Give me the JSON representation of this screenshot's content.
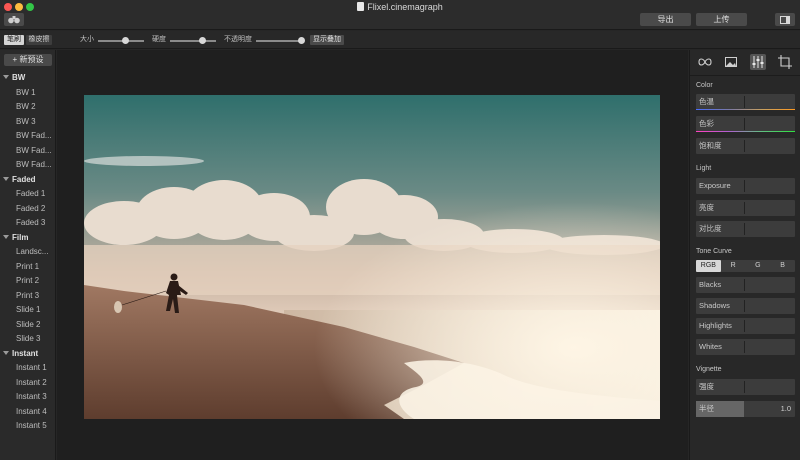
{
  "window": {
    "title": "Flixel.cinemagraph"
  },
  "header": {
    "export_label": "导出",
    "upload_label": "上传"
  },
  "toolbar": {
    "brush_label": "笔刷",
    "eraser_label": "橡皮擦",
    "size_label": "大小",
    "hardness_label": "硬度",
    "opacity_label": "不透明度",
    "show_overlay_label": "显示叠加",
    "size_value": 0.6,
    "hardness_value": 0.7,
    "opacity_value": 0.95
  },
  "sidebar": {
    "new_preset_label": "+ 新预设",
    "groups": [
      {
        "name": "BW",
        "items": [
          "BW 1",
          "BW 2",
          "BW 3",
          "BW Fad...",
          "BW Fad...",
          "BW Fad..."
        ]
      },
      {
        "name": "Faded",
        "items": [
          "Faded 1",
          "Faded 2",
          "Faded 3"
        ]
      },
      {
        "name": "Film",
        "items": [
          "Landsc...",
          "Print 1",
          "Print 2",
          "Print 3",
          "Slide 1",
          "Slide 2",
          "Slide 3"
        ]
      },
      {
        "name": "Instant",
        "items": [
          "Instant 1",
          "Instant 2",
          "Instant 3",
          "Instant 4",
          "Instant 5"
        ]
      }
    ]
  },
  "panel": {
    "mode_icons": [
      "loop-icon",
      "image-icon",
      "sliders-icon",
      "crop-icon"
    ],
    "color": {
      "title": "Color",
      "hue_label": "色温",
      "tint_label": "色彩",
      "saturation_label": "饱和度"
    },
    "light": {
      "title": "Light",
      "exposure_label": "Exposure",
      "brightness_label": "亮度",
      "contrast_label": "对比度"
    },
    "tone_curve": {
      "title": "Tone Curve",
      "tabs": [
        "RGB",
        "R",
        "G",
        "B"
      ],
      "blacks_label": "Blacks",
      "shadows_label": "Shadows",
      "highlights_label": "Highlights",
      "whites_label": "Whites"
    },
    "vignette": {
      "title": "Vignette",
      "strength_label": "强度",
      "radius_label": "半径",
      "radius_value": "1.0"
    }
  },
  "colors": {
    "accent": "#d8d8d8",
    "background": "#262626",
    "control": "#3c3c3c"
  }
}
